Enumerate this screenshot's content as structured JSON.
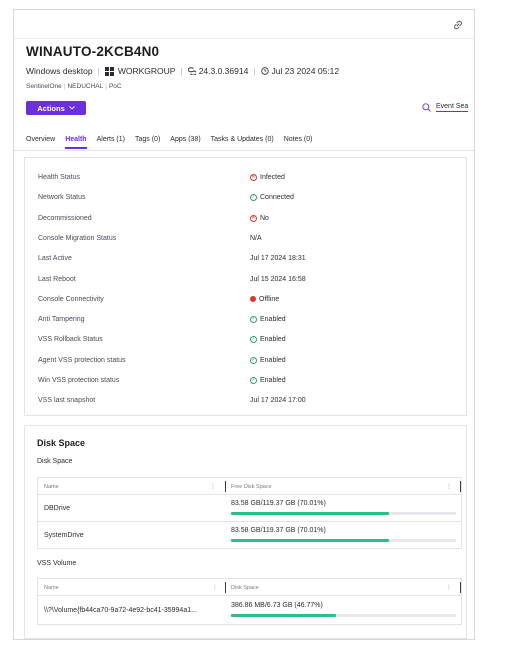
{
  "header": {
    "title": "WINAUTO-2KCB4N0",
    "os": "Windows desktop",
    "domain": "WORKGROUP",
    "version": "24.3.0.36914",
    "timestamp": "Jul 23 2024 05:12",
    "breadcrumb": [
      "SentinelOne",
      "NEDUCHAL",
      "PoC"
    ],
    "link_icon": "link-icon"
  },
  "toolbar": {
    "actions_label": "Actions",
    "event_search_label": "Event Sea"
  },
  "tabs": [
    {
      "label": "Overview",
      "active": false
    },
    {
      "label": "Health",
      "active": true
    },
    {
      "label": "Alerts (1)",
      "active": false
    },
    {
      "label": "Tags (0)",
      "active": false
    },
    {
      "label": "Apps (38)",
      "active": false
    },
    {
      "label": "Tasks & Updates (0)",
      "active": false
    },
    {
      "label": "Notes (0)",
      "active": false
    }
  ],
  "health": [
    {
      "key": "Health Status",
      "value": "Infected",
      "status": "error"
    },
    {
      "key": "Network Status",
      "value": "Connected",
      "status": "ok"
    },
    {
      "key": "Decommissioned",
      "value": "No",
      "status": "error"
    },
    {
      "key": "Console Migration Status",
      "value": "N/A",
      "status": "none"
    },
    {
      "key": "Last Active",
      "value": "Jul 17 2024 18:31",
      "status": "none"
    },
    {
      "key": "Last Reboot",
      "value": "Jul 15 2024 16:58",
      "status": "none"
    },
    {
      "key": "Console Connectivity",
      "value": "Offline",
      "status": "dot"
    },
    {
      "key": "Anti Tampering",
      "value": "Enabled",
      "status": "ok"
    },
    {
      "key": "VSS Rollback Status",
      "value": "Enabled",
      "status": "ok"
    },
    {
      "key": "Agent VSS protection status",
      "value": "Enabled",
      "status": "ok"
    },
    {
      "key": "Win VSS protection status",
      "value": "Enabled",
      "status": "ok"
    },
    {
      "key": "VSS last snapshot",
      "value": "Jul 17 2024 17:00",
      "status": "none"
    }
  ],
  "disk": {
    "title": "Disk Space",
    "disk_sub": "Disk Space",
    "disk_table": {
      "col_name": "Name",
      "col_value": "Free Disk Space",
      "rows": [
        {
          "name": "DBDrive",
          "value": "83.58 GB/119.37 GB (70.01%)",
          "percent": 70.01
        },
        {
          "name": "SystemDrive",
          "value": "83.58 GB/119.37 GB (70.01%)",
          "percent": 70.01
        }
      ]
    },
    "vss_sub": "VSS Volume",
    "vss_table": {
      "col_name": "Name",
      "col_value": "Disk Space",
      "rows": [
        {
          "name": "\\\\?\\Volume{fb44ca70-9a72-4e92-bc41-35994a1...",
          "value": "386.86 MB/6.73 GB (46.77%)",
          "percent": 46.77
        }
      ]
    }
  },
  "colors": {
    "accent": "#6b2fe0",
    "error": "#e0332f",
    "ok": "#2fa36b",
    "bar_fill": "#2fbd8a"
  }
}
